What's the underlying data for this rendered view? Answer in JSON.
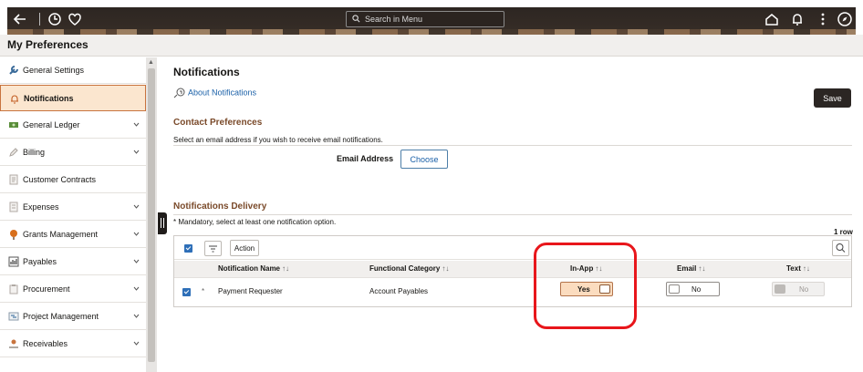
{
  "topbar": {
    "search_placeholder": "Search in Menu"
  },
  "page": {
    "title": "My Preferences"
  },
  "sidebar": {
    "items": [
      {
        "label": "General Settings"
      },
      {
        "label": "Notifications"
      },
      {
        "label": "General Ledger"
      },
      {
        "label": "Billing"
      },
      {
        "label": "Customer Contracts"
      },
      {
        "label": "Expenses"
      },
      {
        "label": "Grants Management"
      },
      {
        "label": "Payables"
      },
      {
        "label": "Procurement"
      },
      {
        "label": "Project Management"
      },
      {
        "label": "Receivables"
      }
    ]
  },
  "main": {
    "heading": "Notifications",
    "about_link": "About Notifications",
    "save_label": "Save",
    "contact": {
      "title": "Contact Preferences",
      "hint": "Select an email address if you wish to receive email notifications.",
      "email_label": "Email Address",
      "choose_label": "Choose"
    },
    "delivery": {
      "title": "Notifications Delivery",
      "note": "* Mandatory, select at least one notification option.",
      "row_count": "1 row",
      "action_label": "Action",
      "columns": [
        "Notification Name",
        "Functional Category",
        "In-App",
        "Email",
        "Text"
      ],
      "sort_glyph": "↑↓",
      "rows": [
        {
          "required": "*",
          "name": "Payment Requester",
          "category": "Account Payables",
          "inapp": "Yes",
          "email": "No",
          "text": "No"
        }
      ]
    }
  },
  "colors": {
    "accent_bg": "#fbe6cf",
    "highlight": "#e8161b",
    "link": "#1a60a8",
    "section_title": "#7a4a2a"
  }
}
